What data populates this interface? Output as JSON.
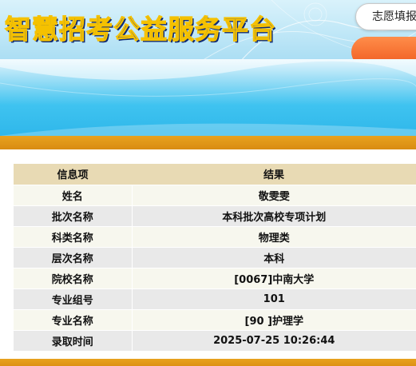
{
  "header": {
    "site_title": "智慧招考公益服务平台",
    "volunteer_tab_label": "志愿填报"
  },
  "table": {
    "columns": [
      "信息项",
      "结果"
    ],
    "rows": [
      {
        "label": "姓名",
        "value": "敬雯雯"
      },
      {
        "label": "批次名称",
        "value": "本科批次高校专项计划"
      },
      {
        "label": "科类名称",
        "value": "物理类"
      },
      {
        "label": "层次名称",
        "value": "本科"
      },
      {
        "label": "院校名称",
        "value": "[0067]中南大学"
      },
      {
        "label": "专业组号",
        "value": "101"
      },
      {
        "label": "专业名称",
        "value": "[90 ]护理学"
      },
      {
        "label": "录取时间",
        "value": "2025-07-25 10:26:44"
      }
    ]
  },
  "colors": {
    "accent_orange": "#d98c12",
    "band_blue": "#3fc3f0",
    "header_gold": "#e8dab4"
  }
}
